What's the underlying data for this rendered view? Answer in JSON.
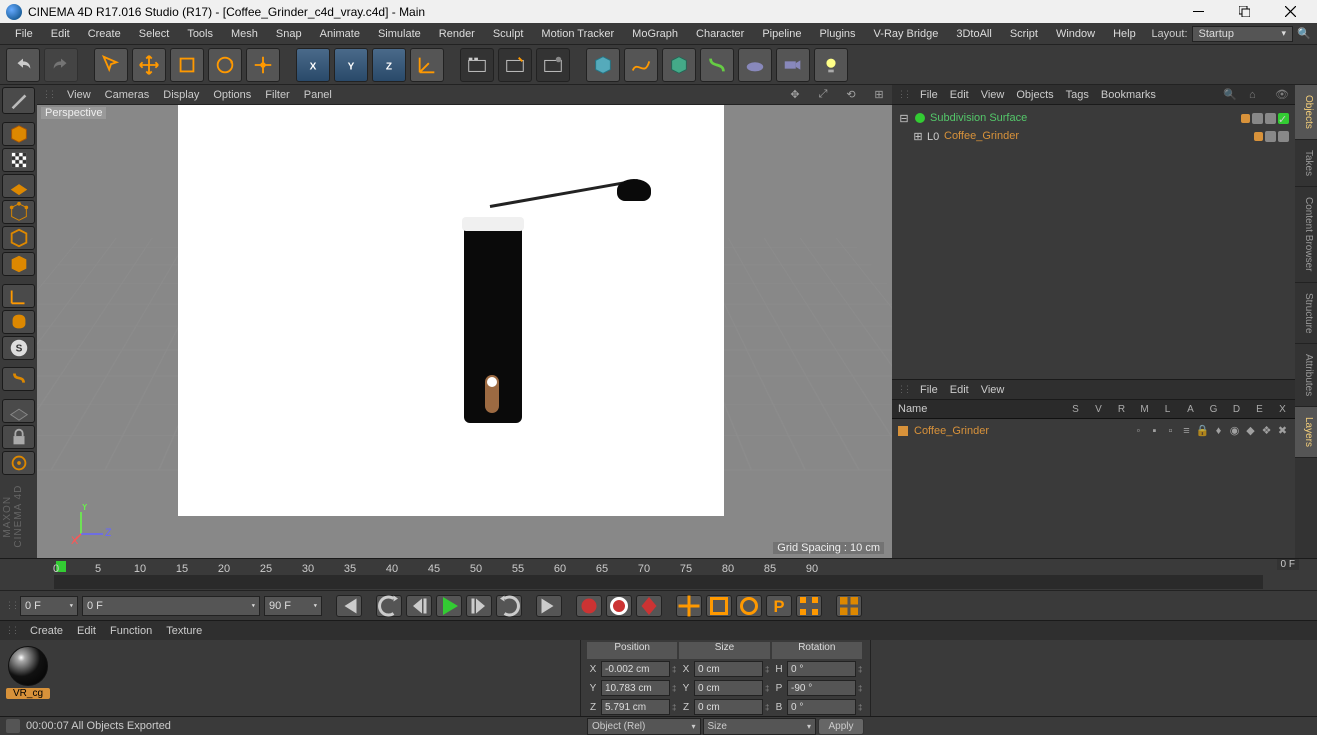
{
  "title": "CINEMA 4D R17.016 Studio (R17) - [Coffee_Grinder_c4d_vray.c4d] - Main",
  "menu": [
    "File",
    "Edit",
    "Create",
    "Select",
    "Tools",
    "Mesh",
    "Snap",
    "Animate",
    "Simulate",
    "Render",
    "Sculpt",
    "Motion Tracker",
    "MoGraph",
    "Character",
    "Pipeline",
    "Plugins",
    "V-Ray Bridge",
    "3DtoAll",
    "Script",
    "Window",
    "Help"
  ],
  "layout_label": "Layout:",
  "layout_value": "Startup",
  "viewport_menu": [
    "View",
    "Cameras",
    "Display",
    "Options",
    "Filter",
    "Panel"
  ],
  "viewport_label": "Perspective",
  "grid_spacing": "Grid Spacing : 10 cm",
  "obj_panel_menu": [
    "File",
    "Edit",
    "View",
    "Objects",
    "Tags",
    "Bookmarks"
  ],
  "tree": [
    {
      "name": "Subdivision Surface",
      "color": "green",
      "indent": 0
    },
    {
      "name": "Coffee_Grinder",
      "color": "orange",
      "indent": 1
    }
  ],
  "layer_panel_menu": [
    "File",
    "Edit",
    "View"
  ],
  "layer_header": [
    "Name",
    "S",
    "V",
    "R",
    "M",
    "L",
    "A",
    "G",
    "D",
    "E",
    "X"
  ],
  "layer_row": "Coffee_Grinder",
  "right_tabs": [
    "Objects",
    "Takes",
    "Content Browser",
    "Structure",
    "Attributes",
    "Layers"
  ],
  "timeline_frames": [
    "0",
    "5",
    "10",
    "15",
    "20",
    "25",
    "30",
    "35",
    "40",
    "45",
    "50",
    "55",
    "60",
    "65",
    "70",
    "75",
    "80",
    "85",
    "90"
  ],
  "timeline_end": "0 F",
  "transport_start": "0 F",
  "transport_cur": "0 F",
  "transport_end": "90 F",
  "bottom_menu": [
    "Create",
    "Edit",
    "Function",
    "Texture"
  ],
  "material_name": "VR_cg",
  "coord_headers": [
    "Position",
    "Size",
    "Rotation"
  ],
  "coords": {
    "px": "-0.002 cm",
    "py": "10.783 cm",
    "pz": "5.791 cm",
    "sx": "0 cm",
    "sy": "0 cm",
    "sz": "0 cm",
    "rh": "0 °",
    "rp": "-90 °",
    "rb": "0 °"
  },
  "coord_mode": "Object (Rel)",
  "size_mode": "Size",
  "apply": "Apply",
  "status": "00:00:07 All Objects Exported"
}
